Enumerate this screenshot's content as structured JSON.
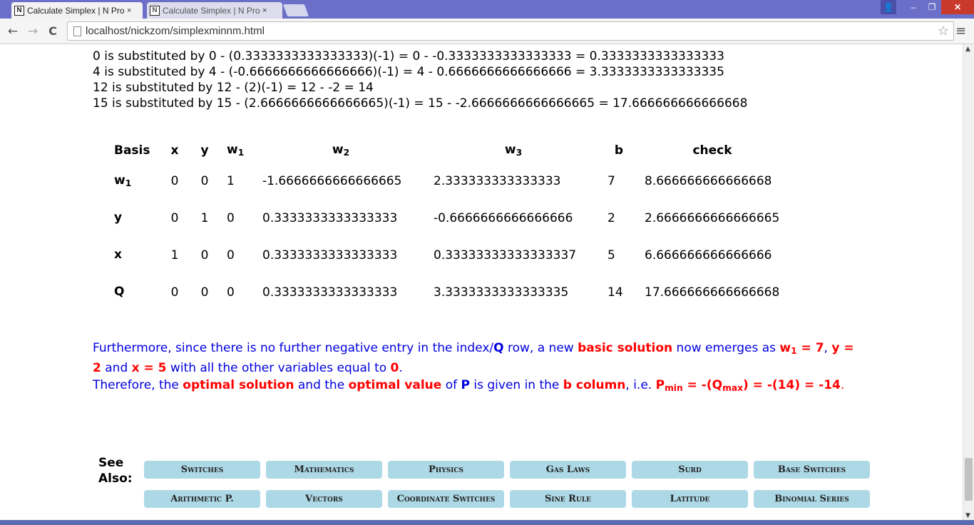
{
  "browser": {
    "tabs": [
      {
        "favicon": "N",
        "title": "Calculate Simplex | N Prob",
        "close": "×"
      },
      {
        "favicon": "N",
        "title": "Calculate Simplex | N Prob",
        "close": "×"
      }
    ],
    "url": "localhost/nickzom/simplexminnm.html",
    "icons": {
      "back": "←",
      "forward": "→",
      "reload": "C",
      "star": "☆",
      "menu": "≡",
      "user": "👤",
      "minimize": "–",
      "maximize": "❐",
      "close": "✕"
    }
  },
  "steps": [
    "0 is substituted by 0 - (0.3333333333333333)(-1) = 0 - -0.3333333333333333 = 0.3333333333333333",
    "4 is substituted by 4 - (-0.6666666666666666)(-1) = 4 - 0.6666666666666666 = 3.3333333333333335",
    "12 is substituted by 12 - (2)(-1) = 12 - -2 = 14",
    "15 is substituted by 15 - (2.6666666666666665)(-1) = 15 - -2.6666666666666665 = 17.666666666666668"
  ],
  "table": {
    "headers": {
      "basis": "Basis",
      "x": "x",
      "y": "y",
      "w1": "w",
      "w1_sub": "1",
      "w2": "w",
      "w2_sub": "2",
      "w3": "w",
      "w3_sub": "3",
      "b": "b",
      "check": "check"
    },
    "rows": [
      {
        "basis": "w",
        "basis_sub": "1",
        "x": "0",
        "y": "0",
        "w1": "1",
        "w2": "-1.6666666666666665",
        "w3": "2.333333333333333",
        "b": "7",
        "check": "8.666666666666668"
      },
      {
        "basis": "y",
        "basis_sub": "",
        "x": "0",
        "y": "1",
        "w1": "0",
        "w2": "0.3333333333333333",
        "w3": "-0.6666666666666666",
        "b": "2",
        "check": "2.6666666666666665"
      },
      {
        "basis": "x",
        "basis_sub": "",
        "x": "1",
        "y": "0",
        "w1": "0",
        "w2": "0.3333333333333333",
        "w3": "0.33333333333333337",
        "b": "5",
        "check": "6.666666666666666"
      },
      {
        "basis": "Q",
        "basis_sub": "",
        "x": "0",
        "y": "0",
        "w1": "0",
        "w2": "0.3333333333333333",
        "w3": "3.3333333333333335",
        "b": "14",
        "check": "17.666666666666668"
      }
    ]
  },
  "conclusion": {
    "p1_a": "Furthermore, since there is no further negative entry in the index/",
    "p1_q": "Q",
    "p1_b": " row, a new ",
    "p1_basic": "basic solution",
    "p1_c": " now emerges as ",
    "p1_w": "w",
    "p1_w_sub": "1",
    "p1_w_val": " = 7",
    "p1_sep1": ", ",
    "p1_y": "y = 2",
    "p1_and": " and ",
    "p1_x": "x = 5",
    "p1_d": " with all the other variables equal to ",
    "p1_zero": "0",
    "p1_end": ".",
    "p2_a": "Therefore, the ",
    "p2_opt_sol": "optimal solution",
    "p2_b": " and the ",
    "p2_opt_val": "optimal value",
    "p2_c": " of ",
    "p2_p": "P",
    "p2_d": " is given in the ",
    "p2_bcol": "b column",
    "p2_e": ", i.e. ",
    "p2_pmin": "P",
    "p2_pmin_sub": "min",
    "p2_f": " = -(Q",
    "p2_qmax_sub": "max",
    "p2_g": ") = -(14) = -14",
    "p2_end": "."
  },
  "see_also": {
    "label_1": "See",
    "label_2": "Also:",
    "links": [
      "Switches",
      "Mathematics",
      "Physics",
      "Gas Laws",
      "Surd",
      "Base Switches",
      "Arithmetic P.",
      "Vectors",
      "Coordinate Switches",
      "Sine Rule",
      "Latitude",
      "Binomial Series"
    ]
  },
  "scrollbar": {
    "up": "▲",
    "down": "▼"
  }
}
